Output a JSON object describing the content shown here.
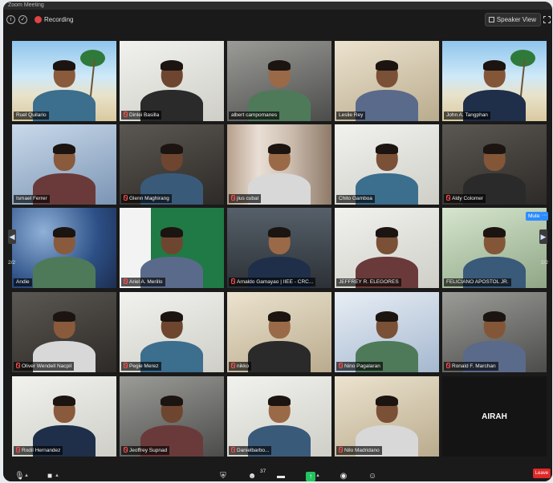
{
  "window": {
    "title": "Zoom Meeting"
  },
  "topbar": {
    "info_icon": "info-icon",
    "shield_icon": "shield-icon",
    "recording_label": "Recording",
    "speaker_view_label": "Speaker View",
    "fullscreen_icon": "fullscreen-icon"
  },
  "paging": {
    "left_page": "2/2",
    "right_page": "2/2"
  },
  "hover": {
    "mute_label": "Mute",
    "more_label": "···"
  },
  "participants": [
    {
      "name": "Ruel Quilario",
      "muted": false
    },
    {
      "name": "Dinlei Basilla",
      "muted": true
    },
    {
      "name": "albert campomanes",
      "muted": false
    },
    {
      "name": "Leslie Rey",
      "muted": false
    },
    {
      "name": "John A. Tangphan",
      "muted": false
    },
    {
      "name": "Ismael Ferrer",
      "muted": false
    },
    {
      "name": "Glenn Maghirang",
      "muted": true
    },
    {
      "name": "jlus cubal",
      "muted": true
    },
    {
      "name": "Chito Gamboa",
      "muted": false
    },
    {
      "name": "Aldy Colomer",
      "muted": true
    },
    {
      "name": "Andie",
      "muted": false
    },
    {
      "name": "Ariel A. Merillo",
      "muted": true
    },
    {
      "name": "Arnaldo Gamayao | IIEE - CRC...",
      "muted": true
    },
    {
      "name": "JEFFREY R. ELEGORES",
      "muted": false
    },
    {
      "name": "FELICIANO APOSTOL JR.",
      "muted": false
    },
    {
      "name": "Oliver Wendell Nacpil",
      "muted": true
    },
    {
      "name": "Pegie Merez",
      "muted": true
    },
    {
      "name": "nikko",
      "muted": true
    },
    {
      "name": "Nino Pagalaran",
      "muted": true
    },
    {
      "name": "Ronald F. Marchan",
      "muted": true
    },
    {
      "name": "Rodil Hernandez",
      "muted": true
    },
    {
      "name": "Jeoffrey Supnad",
      "muted": true
    },
    {
      "name": "Danielbarbo...",
      "muted": true
    },
    {
      "name": "Nilo Madridano",
      "muted": true
    },
    {
      "name": "AIRAH",
      "muted": false,
      "no_video": true
    }
  ],
  "toolbar": {
    "mic_icon": "microphone-icon",
    "video_icon": "video-camera-icon",
    "security_icon": "shield-icon",
    "participants_icon": "participants-icon",
    "participants_count": "37",
    "chat_icon": "chat-icon",
    "share_icon": "share-screen-icon",
    "record_icon": "record-icon",
    "reactions_icon": "reactions-icon",
    "leave_label": "Leave"
  },
  "colors": {
    "accent": "#2d8cff",
    "recording": "#e04343",
    "share": "#23c55e",
    "leave": "#e02828",
    "muted": "#ff4d4d"
  }
}
